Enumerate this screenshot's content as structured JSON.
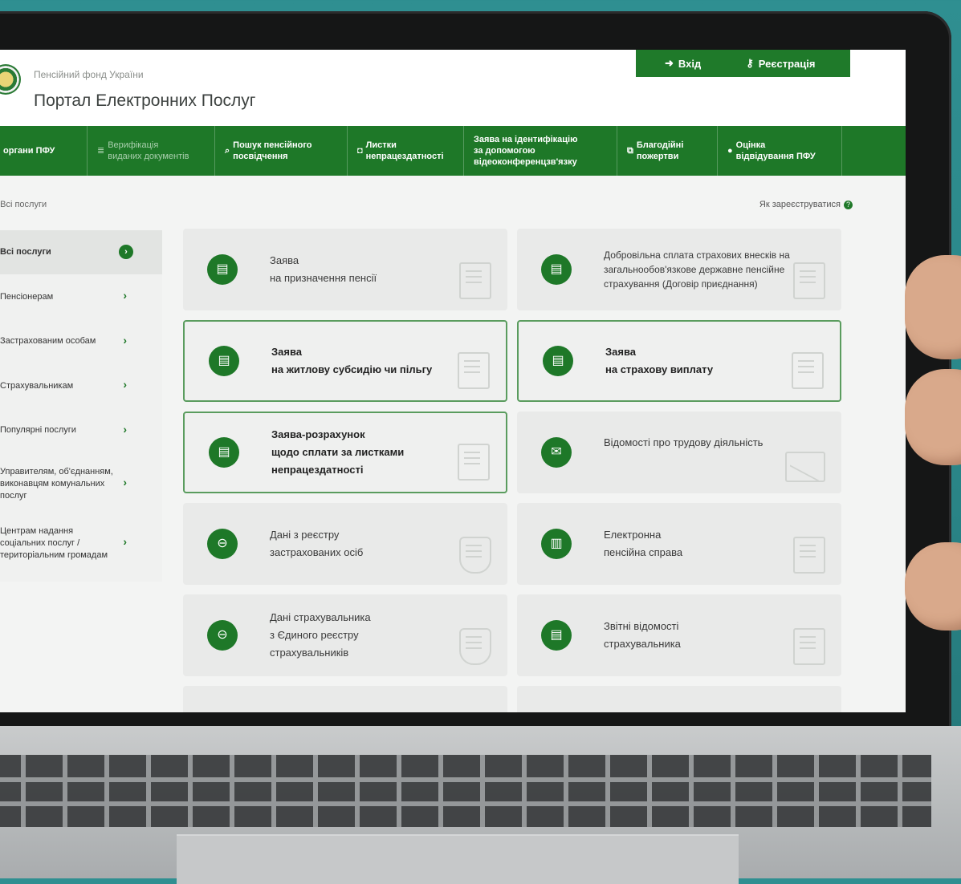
{
  "header": {
    "org_name": "Пенсійний фонд України",
    "portal_title": "Портал Електронних Послуг",
    "login_label": "Вхід",
    "register_label": "Реєстрація"
  },
  "nav": [
    {
      "label": "органи ПФУ",
      "style": "normal"
    },
    {
      "label": "Верифікація\nвиданих документів",
      "style": "dim",
      "icon": "checklist-icon"
    },
    {
      "label": "Пошук пенсійного\nпосвідчення",
      "style": "normal",
      "icon": "search-icon"
    },
    {
      "label": "Листки\nнепрацездатності",
      "style": "normal",
      "icon": "camera-icon"
    },
    {
      "label": "Заява на ідентифікацію\nза допомогою\nвідеоконференцзв'язку",
      "style": "normal"
    },
    {
      "label": "Благодійні\nпожертви",
      "style": "normal",
      "icon": "copy-icon"
    },
    {
      "label": "Оцінка\nвідвідування ПФУ",
      "style": "normal",
      "icon": "speech-bubble-icon"
    }
  ],
  "breadcrumb": "/ Всі послуги",
  "help_link": "Як зареєструватися",
  "sidebar": [
    {
      "label": "Всі послуги",
      "active": true
    },
    {
      "label": "Пенсіонерам"
    },
    {
      "label": "Застрахованим особам"
    },
    {
      "label": "Страхувальникам"
    },
    {
      "label": "Популярні послуги"
    },
    {
      "label": "Управителям, об'єднанням,\nвиконавцям комунальних\nпослуг"
    },
    {
      "label": "Центрам надання\nсоціальних послуг /\nтериторіальним громадам"
    }
  ],
  "cards": [
    {
      "text": "Заява\nна призначення пенсії",
      "highlighted": false,
      "icon": "document-icon"
    },
    {
      "text": "Добровільна сплата страхових внесків на загальнообов'язкове державне пенсійне страхування (Договір приєднання)",
      "highlighted": false,
      "icon": "document-icon"
    },
    {
      "text": "Заява\nна житлову субсидію чи пільгу",
      "highlighted": true,
      "icon": "document-icon"
    },
    {
      "text": "Заява\nна страхову виплату",
      "highlighted": true,
      "icon": "document-icon"
    },
    {
      "text": "Заява-розрахунок\nщодо сплати за листками\nнепрацездатності",
      "highlighted": true,
      "icon": "document-icon"
    },
    {
      "text": "Відомості про трудову діяльність",
      "highlighted": false,
      "icon": "envelope-icon"
    },
    {
      "text": "Дані з реєстру\nзастрахованих осіб",
      "highlighted": false,
      "icon": "shield-icon"
    },
    {
      "text": "Електронна\nпенсійна справа",
      "highlighted": false,
      "icon": "folder-icon"
    },
    {
      "text": "Дані страхувальника\nз Єдиного реєстру\nстрахувальників",
      "highlighted": false,
      "icon": "shield-icon"
    },
    {
      "text": "Звітні відомості\nстрахувальника",
      "highlighted": false,
      "icon": "report-icon"
    }
  ],
  "colors": {
    "brand_green": "#1e7828",
    "highlight_border": "#5a9c5e"
  }
}
